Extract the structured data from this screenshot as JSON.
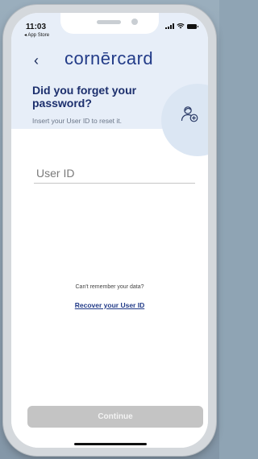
{
  "status_bar": {
    "time": "11:03",
    "back_app": "◂ App Store"
  },
  "header": {
    "logo": "cornērcard",
    "back_symbol": "‹"
  },
  "intro": {
    "title": "Did you forget your password?",
    "subtitle": "Insert your User ID to reset it."
  },
  "form": {
    "user_id_placeholder": "User ID",
    "user_id_value": ""
  },
  "help": {
    "hint": "Can't remember your data?",
    "recover_link": "Recover your User ID"
  },
  "actions": {
    "continue_label": "Continue"
  },
  "icons": {
    "back": "chevron-left-icon",
    "user": "user-plus-icon",
    "signal": "signal-icon",
    "wifi": "wifi-icon",
    "battery": "battery-icon"
  },
  "colors": {
    "brand": "#223b88",
    "header_bg": "#e7eef8",
    "button_disabled": "#c4c4c4"
  }
}
